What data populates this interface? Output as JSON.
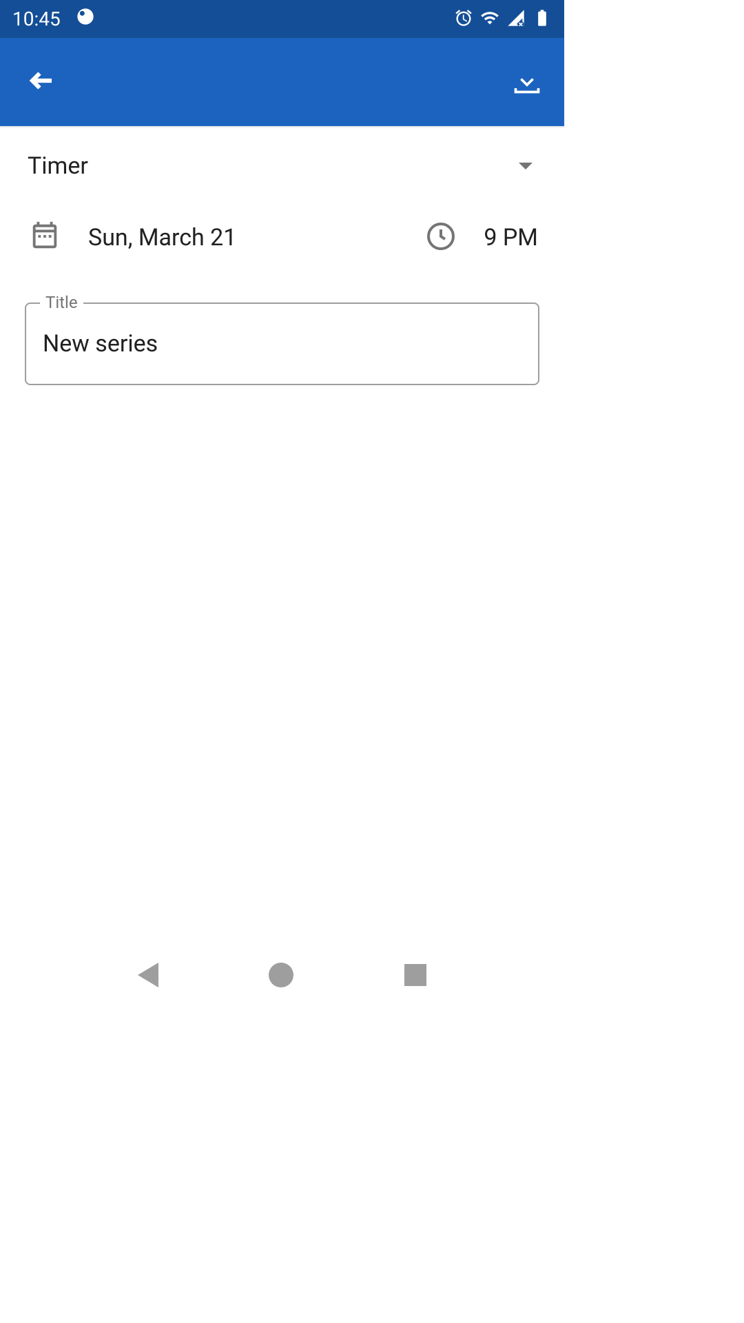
{
  "status": {
    "time": "10:45"
  },
  "form": {
    "type_label": "Timer",
    "date": "Sun, March 21",
    "time": "9 PM",
    "title_label": "Title",
    "title_value": "New series"
  }
}
